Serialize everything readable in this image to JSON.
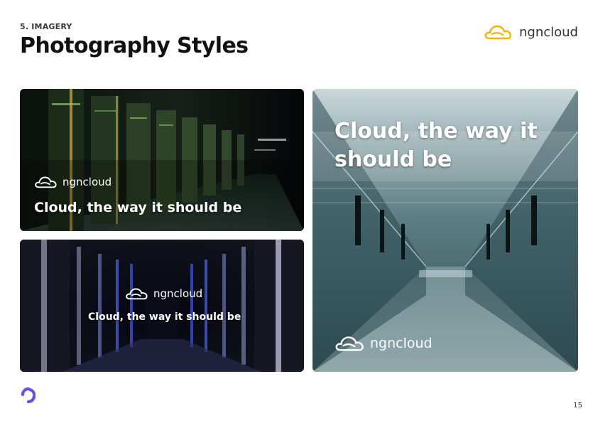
{
  "header": {
    "section_label": "5. IMAGERY",
    "title": "Photography Styles",
    "brand_name": "ngncloud"
  },
  "photos": [
    {
      "brand_name": "ngncloud",
      "tagline": "Cloud, the way it should be"
    },
    {
      "brand_name": "ngncloud",
      "tagline": "Cloud, the way it should be"
    },
    {
      "brand_name": "ngncloud",
      "tagline": "Cloud, the way it should be"
    }
  ],
  "footer": {
    "page_number": "15"
  },
  "colors": {
    "brand_accent": "#F5B400",
    "corner_logo": "#6B4EE6",
    "title_text": "#111111"
  },
  "icons": [
    "cloud-logo-icon",
    "corner-logo-icon"
  ]
}
